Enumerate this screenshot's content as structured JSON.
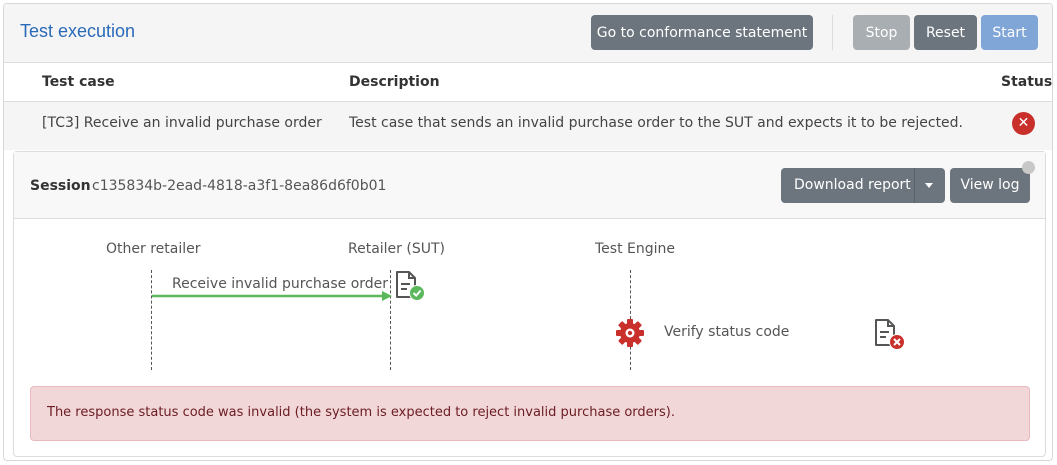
{
  "header": {
    "title": "Test execution",
    "conformance_label": "Go to conformance statement",
    "stop_label": "Stop",
    "reset_label": "Reset",
    "start_label": "Start"
  },
  "table": {
    "columns": [
      "Test case",
      "Description",
      "Status"
    ],
    "rows": [
      {
        "test_case": "[TC3] Receive an invalid purchase order",
        "description": "Test case that sends an invalid purchase order to the SUT and expects it to be rejected.",
        "status": "error"
      }
    ]
  },
  "session": {
    "label": "Session",
    "id": "c135834b-2ead-4818-a3f1-8ea86d6f0b01",
    "download_label": "Download report",
    "view_log_label": "View log"
  },
  "diagram": {
    "actors": [
      "Other retailer",
      "Retailer (SUT)",
      "Test Engine"
    ],
    "message_label": "Receive invalid purchase order",
    "message_status": "success",
    "verify_label": "Verify status code",
    "verify_status": "error"
  },
  "alert": {
    "text": "The response status code was invalid (the system is expected to reject invalid purchase orders)."
  },
  "colors": {
    "title_blue": "#2a6ab8",
    "button_gray": "#6c757d",
    "start_blue": "#7fa6d6",
    "error_red": "#c9302c",
    "success_green": "#5cb85c",
    "arrow_green": "#5cb85c",
    "alert_bg": "#f2d7d9"
  }
}
